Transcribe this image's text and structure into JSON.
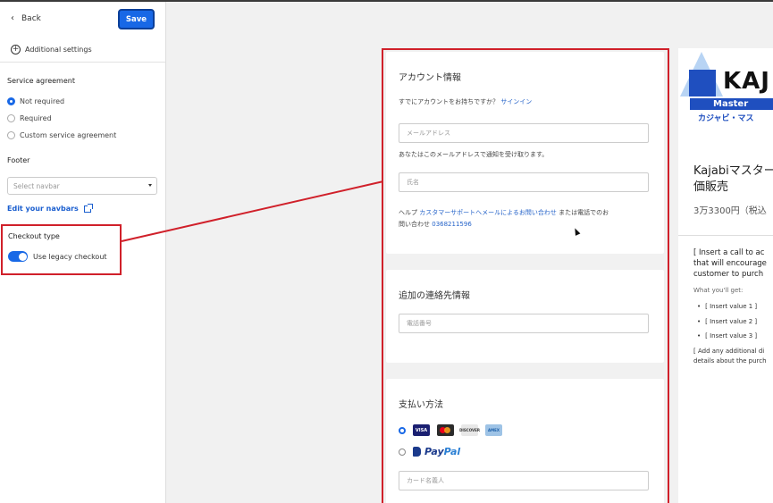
{
  "sidebar": {
    "back_label": "Back",
    "save_label": "Save",
    "additional_settings_label": "Additional settings",
    "service_agreement": {
      "title": "Service agreement",
      "options": [
        "Not required",
        "Required",
        "Custom service agreement"
      ],
      "selected": "Not required"
    },
    "footer": {
      "title": "Footer",
      "select_placeholder": "Select navbar",
      "edit_link": "Edit your navbars"
    },
    "checkout_type": {
      "title": "Checkout type",
      "toggle_label": "Use legacy checkout",
      "toggle_on": true
    }
  },
  "checkout": {
    "account": {
      "title": "アカウント情報",
      "have_account_text": "すでにアカウントをお持ちですか？",
      "signin_link": "サインイン",
      "email_placeholder": "メールアドレス",
      "email_note": "あなたはこのメールアドレスで通知を受け取ります。",
      "name_placeholder": "氏名",
      "help_prefix": "ヘルプ",
      "help_link": "カスタマーサポートへメールによるお問い合わせ",
      "help_middle": "または電話でのお",
      "help_line2": "問い合わせ",
      "phone_link": "0368211596"
    },
    "contact": {
      "title": "追加の連絡先情報",
      "phone_placeholder": "電話番号"
    },
    "payment": {
      "title": "支払い方法",
      "card_brands": [
        "VISA",
        "MC",
        "DISCOVER",
        "AMEX"
      ],
      "paypal_pay": "Pay",
      "paypal_pal": "Pal",
      "cardholder_placeholder": "カード名義人"
    }
  },
  "product": {
    "logo_text": "KAJ",
    "logo_master": "Master",
    "logo_kana": "カジャビ・マス",
    "title_line1": "Kajabiマスター",
    "title_line2": "価販売",
    "price": "3万3300円（税込",
    "desc_line1": "[ Insert a call to ac",
    "desc_line2": "that will encourage",
    "desc_line3": "customer to purch",
    "what_youll_get": "What you'll get:",
    "bullets": [
      "[ Insert value 1 ]",
      "[ Insert value 2 ]",
      "[ Insert value 3 ]"
    ],
    "more_line1": "[ Add any additional di",
    "more_line2": "details about the purch"
  },
  "colors": {
    "accent": "#1868e6",
    "highlight": "#d0202a",
    "link": "#2563c9"
  }
}
